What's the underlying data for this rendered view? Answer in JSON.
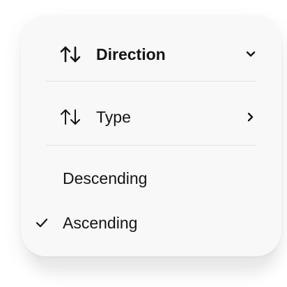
{
  "menu": {
    "direction": {
      "label": "Direction",
      "icon": "sort-arrows-icon",
      "chevron": "chevron-down-icon"
    },
    "type": {
      "label": "Type",
      "icon": "sort-arrows-icon",
      "chevron": "chevron-right-icon"
    },
    "options": [
      {
        "label": "Descending",
        "selected": false
      },
      {
        "label": "Ascending",
        "selected": true
      }
    ]
  },
  "colors": {
    "text": "#141414",
    "background": "#f8f8f8",
    "divider": "#e2e2e2"
  }
}
